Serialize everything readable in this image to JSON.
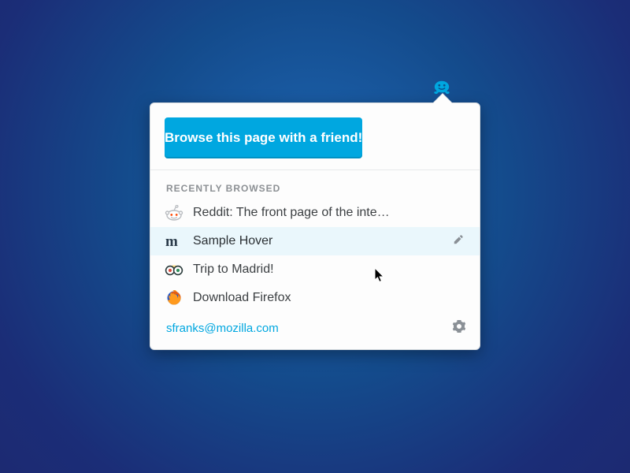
{
  "colors": {
    "accent": "#00a7e0",
    "hover_bg": "#eaf7fc"
  },
  "anchor_icon": "smiley-icon",
  "primary_button": "Browse this page with a friend!",
  "section_header": "RECENTLY BROWSED",
  "items": [
    {
      "icon": "reddit-icon",
      "title": "Reddit: The front page of the inte…",
      "hover": false
    },
    {
      "icon": "m-icon",
      "title": "Sample Hover",
      "hover": true
    },
    {
      "icon": "tripadvisor-icon",
      "title": "Trip to Madrid!",
      "hover": false
    },
    {
      "icon": "firefox-icon",
      "title": "Download Firefox",
      "hover": false
    }
  ],
  "footer": {
    "email": "sfranks@mozilla.com"
  }
}
